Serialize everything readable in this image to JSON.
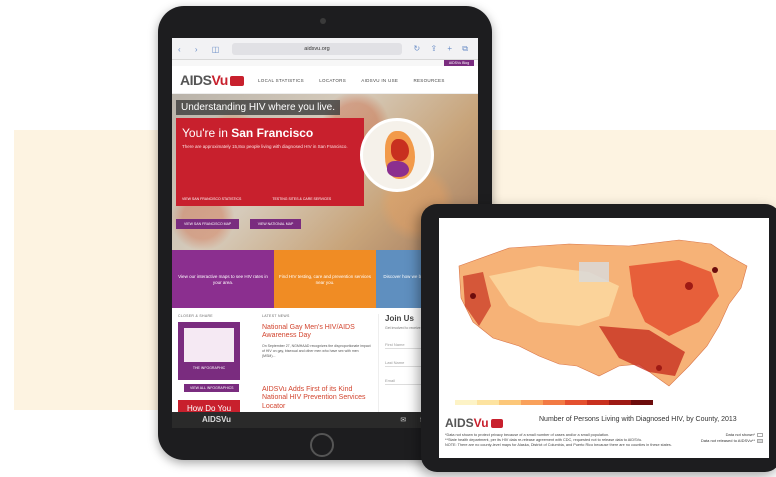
{
  "safari": {
    "nav_glyphs": "‹ › ◫ ⊞",
    "url": "aidsvu.org",
    "actions": "↻ ⇪ + ⧉"
  },
  "site": {
    "logo_text_a": "AIDS",
    "logo_text_b": "Vu",
    "subscribe_label": "AIDSVu Blog",
    "nav": [
      "LOCAL STATISTICS",
      "LOCATORS",
      "AIDSVU IN USE",
      "RESOURCES"
    ],
    "hero": {
      "tagline": "Understanding HIV where you live.",
      "location_prefix": "You're in",
      "location_name": "San Francisco",
      "description": "There are approximately 15,8xx people living with diagnosed HIV in San Francisco.",
      "stat_left": "VIEW SAN FRANCISCO STATISTICS",
      "stat_right": "TESTING SITES & CARE SERVICES",
      "btn_left": "VIEW SAN FRANCISCO MAP",
      "btn_right": "VIEW NATIONAL MAP"
    },
    "tiles": [
      {
        "text": "View our interactive maps to see HIV rates in your area."
      },
      {
        "text": "Find HIV testing, care and prevention services near you."
      },
      {
        "text": "Discover how we bring data to maps in your area."
      }
    ],
    "lower": {
      "col1_head": "CLOSER & SHARE",
      "col2_head": "LATEST NEWS",
      "infographic_caption": "THE INFOGRAPHIC",
      "all_infographics": "VIEW ALL INFOGRAPHICS",
      "how_do_you": "How Do You AIDSVu?",
      "news1_title": "National Gay Men's HIV/AIDS Awareness Day",
      "news1_body": "On September 27, NGMHAAD recognizes the disproportionate impact of HIV on gay, bisexual and other men who have sex with men (MSM)...",
      "news2_title": "AIDSVu Adds First of its Kind National HIV Prevention Services Locator",
      "join_title": "Join Us",
      "join_note": "Get involved to receive updates",
      "field_first": "First Name",
      "field_last": "Last Name",
      "field_email": "Email",
      "submit": "Submit"
    },
    "footer": {
      "logo": "AIDSVu",
      "social": "✉ f ✓ ◎"
    }
  },
  "tablet": {
    "logo_text_a": "AIDS",
    "logo_text_b": "Vu",
    "title": "Number of Persons Living with Diagnosed HIV, by County, 2013",
    "notes": [
      "*Data not shown to protect privacy because of a small number of cases and/or a small population.",
      "**State health department, per its HIV data re-release agreement with CDC, requested not to release data to AIDSVu.",
      "NOTE: There are no county-level maps for Alaska, District of Columbia, and Puerto Rico because there are no counties in these states."
    ],
    "key_not_shown": "Data not shown*",
    "key_not_released": "Data not released to AIDSVu**",
    "legend_colors": [
      "#fdf3c6",
      "#fde3a0",
      "#fcc779",
      "#f9a15b",
      "#f27a44",
      "#e4502f",
      "#c8301f",
      "#9e1a14",
      "#6c0c0c"
    ]
  }
}
